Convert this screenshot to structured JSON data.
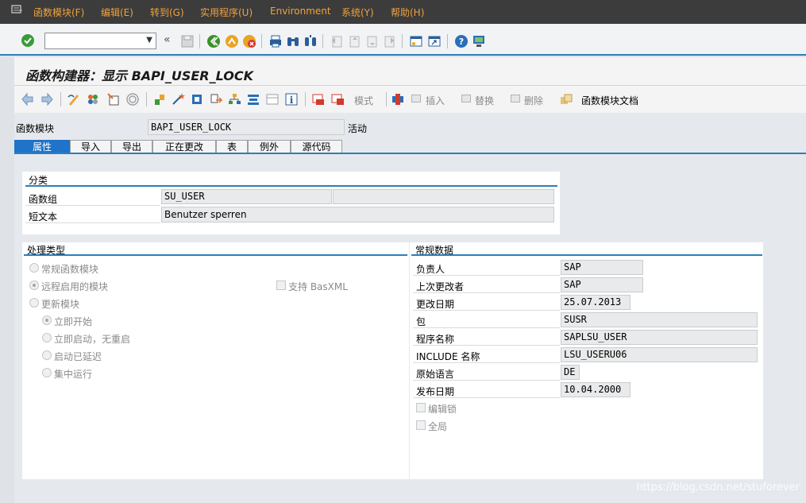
{
  "menu": [
    "函数模块(F)",
    "编辑(E)",
    "转到(G)",
    "实用程序(U)",
    "Environment",
    "系统(Y)",
    "帮助(H)"
  ],
  "colors": {
    "menu_text": "#f0a23c",
    "accent": "#2c7fb8",
    "tab_selected": "#1f73c8"
  },
  "title": "函数构建器：显示 BAPI_USER_LOCK",
  "app_toolbar": {
    "mode": "模式",
    "insert": "插入",
    "replace": "替换",
    "delete": "删除",
    "docs": "函数模块文档"
  },
  "header": {
    "label": "函数模块",
    "value": "BAPI_USER_LOCK",
    "status": "活动"
  },
  "tabs": [
    "属性",
    "导入",
    "导出",
    "正在更改",
    "表",
    "例外",
    "源代码"
  ],
  "classification": {
    "title": "分类",
    "function_group_label": "函数组",
    "function_group": "SU_USER",
    "function_group_desc": "",
    "short_text_label": "短文本",
    "short_text": "Benutzer sperren"
  },
  "processing_type": {
    "title": "处理类型",
    "normal": "常规函数模块",
    "remote": "远程启用的模块",
    "basxml": "支持 BasXML",
    "update": "更新模块",
    "immediate": "立即开始",
    "immediate_no_restart": "立即启动，无重启",
    "delayed": "启动已延迟",
    "collective": "集中运行"
  },
  "general_data": {
    "title": "常规数据",
    "rows": [
      {
        "label": "负责人",
        "value": "SAP"
      },
      {
        "label": "上次更改者",
        "value": "SAP"
      },
      {
        "label": "更改日期",
        "value": "25.07.2013"
      },
      {
        "label": "包",
        "value": "SUSR"
      },
      {
        "label": "程序名称",
        "value": "SAPLSU_USER"
      },
      {
        "label": "INCLUDE 名称",
        "value": "LSU_USERU06"
      },
      {
        "label": "原始语言",
        "value": "DE"
      },
      {
        "label": "发布日期",
        "value": "10.04.2000"
      }
    ],
    "edit_lock": "编辑锁",
    "global": "全局"
  },
  "watermark": "https://blog.csdn.net/stuforever"
}
